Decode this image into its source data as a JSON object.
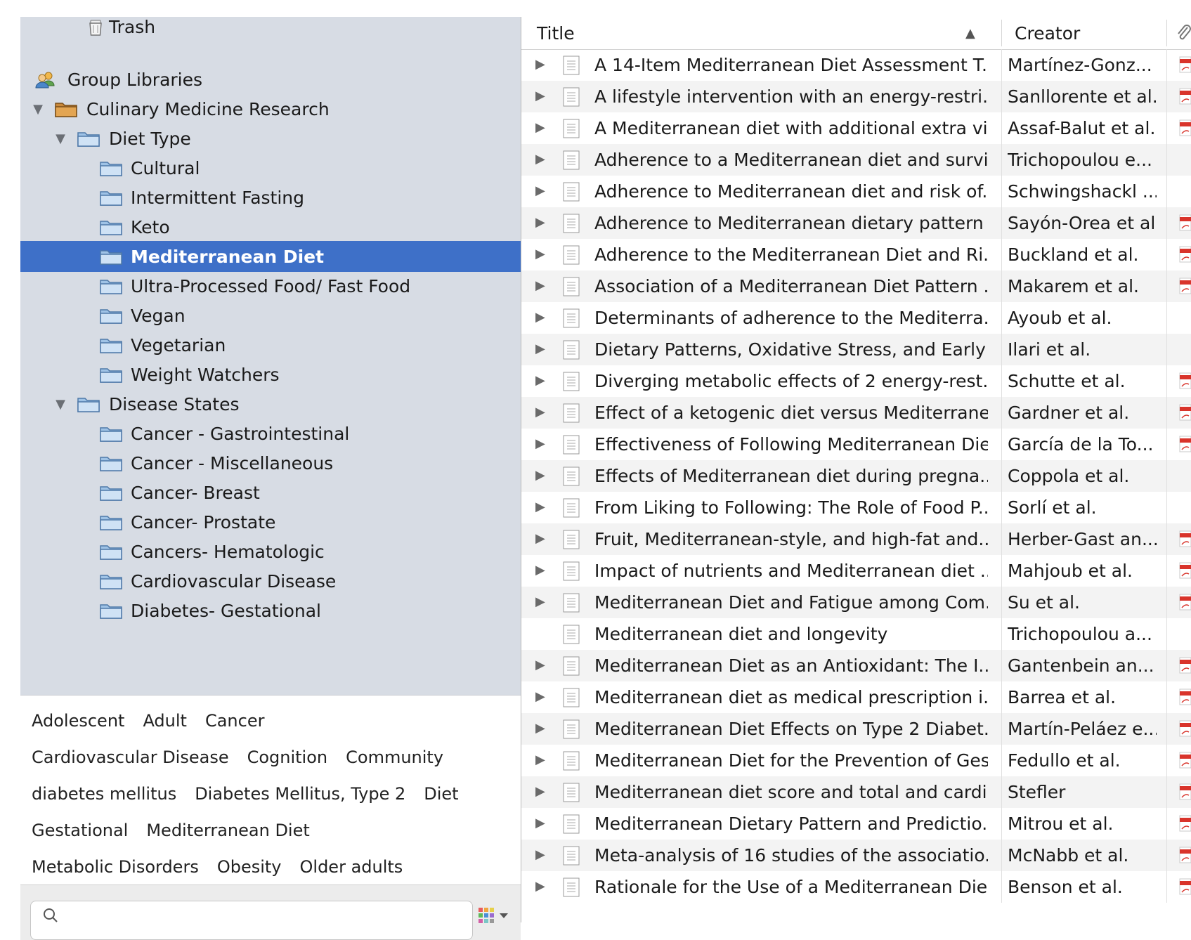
{
  "sidebar": {
    "items": [
      {
        "label": "Trash",
        "icon": "trash-icon",
        "level": 2,
        "twisty": "none"
      },
      {
        "label": "Group Libraries",
        "icon": "group-icon",
        "level": 0,
        "twisty": "none"
      },
      {
        "label": "Culinary Medicine Research",
        "icon": "library-icon",
        "level": 0,
        "twisty": "open"
      },
      {
        "label": "Diet Type",
        "icon": "folder-icon",
        "level": 1,
        "twisty": "open"
      },
      {
        "label": "Cultural",
        "icon": "folder-icon",
        "level": 2,
        "twisty": "none"
      },
      {
        "label": "Intermittent Fasting",
        "icon": "folder-icon",
        "level": 2,
        "twisty": "none"
      },
      {
        "label": "Keto",
        "icon": "folder-icon",
        "level": 2,
        "twisty": "none"
      },
      {
        "label": "Mediterranean Diet",
        "icon": "folder-icon",
        "level": 2,
        "twisty": "none",
        "selected": true
      },
      {
        "label": "Ultra-Processed Food/ Fast Food",
        "icon": "folder-icon",
        "level": 2,
        "twisty": "none"
      },
      {
        "label": "Vegan",
        "icon": "folder-icon",
        "level": 2,
        "twisty": "none"
      },
      {
        "label": "Vegetarian",
        "icon": "folder-icon",
        "level": 2,
        "twisty": "none"
      },
      {
        "label": "Weight Watchers",
        "icon": "folder-icon",
        "level": 2,
        "twisty": "none"
      },
      {
        "label": "Disease States",
        "icon": "folder-icon",
        "level": 1,
        "twisty": "open"
      },
      {
        "label": "Cancer - Gastrointestinal",
        "icon": "folder-icon",
        "level": 2,
        "twisty": "none"
      },
      {
        "label": "Cancer - Miscellaneous",
        "icon": "folder-icon",
        "level": 2,
        "twisty": "none"
      },
      {
        "label": "Cancer- Breast",
        "icon": "folder-icon",
        "level": 2,
        "twisty": "none"
      },
      {
        "label": "Cancer- Prostate",
        "icon": "folder-icon",
        "level": 2,
        "twisty": "none"
      },
      {
        "label": "Cancers- Hematologic",
        "icon": "folder-icon",
        "level": 2,
        "twisty": "none"
      },
      {
        "label": "Cardiovascular Disease",
        "icon": "folder-icon",
        "level": 2,
        "twisty": "none"
      },
      {
        "label": "Diabetes- Gestational",
        "icon": "folder-icon",
        "level": 2,
        "twisty": "none"
      }
    ]
  },
  "tags": {
    "lines": [
      [
        "Adolescent",
        "Adult",
        "Cancer"
      ],
      [
        "Cardiovascular Disease",
        "Cognition",
        "Community"
      ],
      [
        "diabetes mellitus",
        "Diabetes Mellitus, Type 2",
        "Diet"
      ],
      [
        "Gestational",
        "Mediterranean Diet"
      ],
      [
        "Metabolic Disorders",
        "Obesity",
        "Older adults"
      ]
    ]
  },
  "search": {
    "placeholder": ""
  },
  "columns": {
    "title": "Title",
    "creator": "Creator",
    "sort_indicator": "▲"
  },
  "items": [
    {
      "title": "A 14-Item Mediterranean Diet Assessment T...",
      "creator": "Martínez-Gonz...",
      "pdf": true,
      "expand": true
    },
    {
      "title": "A lifestyle intervention with an energy-restri...",
      "creator": "Sanllorente et al.",
      "pdf": true,
      "expand": true
    },
    {
      "title": "A Mediterranean diet with additional extra vi...",
      "creator": "Assaf-Balut et al.",
      "pdf": true,
      "expand": true
    },
    {
      "title": "Adherence to a Mediterranean diet and survi...",
      "creator": "Trichopoulou e...",
      "pdf": false,
      "expand": true
    },
    {
      "title": "Adherence to Mediterranean diet and risk of...",
      "creator": "Schwingshackl ...",
      "pdf": false,
      "expand": true
    },
    {
      "title": "Adherence to Mediterranean dietary pattern ...",
      "creator": "Sayón-Orea et al.",
      "pdf": true,
      "expand": true
    },
    {
      "title": "Adherence to the Mediterranean Diet and Ri...",
      "creator": "Buckland et al.",
      "pdf": true,
      "expand": true
    },
    {
      "title": "Association of a Mediterranean Diet Pattern ...",
      "creator": "Makarem et al.",
      "pdf": true,
      "expand": true
    },
    {
      "title": "Determinants of adherence to the Mediterra...",
      "creator": "Ayoub et al.",
      "pdf": false,
      "expand": true
    },
    {
      "title": "Dietary Patterns, Oxidative Stress, and Early ...",
      "creator": "Ilari et al.",
      "pdf": false,
      "expand": true
    },
    {
      "title": "Diverging metabolic effects of 2 energy-rest...",
      "creator": "Schutte et al.",
      "pdf": true,
      "expand": true
    },
    {
      "title": "Effect of a ketogenic diet versus Mediterrane...",
      "creator": "Gardner et al.",
      "pdf": true,
      "expand": true
    },
    {
      "title": "Effectiveness of Following Mediterranean Die...",
      "creator": "García de la To...",
      "pdf": true,
      "expand": true
    },
    {
      "title": "Effects of Mediterranean diet during pregna...",
      "creator": "Coppola et al.",
      "pdf": false,
      "expand": true
    },
    {
      "title": "From Liking to Following: The Role of Food P...",
      "creator": "Sorlí et al.",
      "pdf": false,
      "expand": true
    },
    {
      "title": "Fruit, Mediterranean-style, and high-fat and...",
      "creator": "Herber-Gast an...",
      "pdf": true,
      "expand": true
    },
    {
      "title": "Impact of nutrients and Mediterranean diet ...",
      "creator": "Mahjoub et al.",
      "pdf": true,
      "expand": true
    },
    {
      "title": "Mediterranean Diet and Fatigue among Com...",
      "creator": "Su et al.",
      "pdf": true,
      "expand": true
    },
    {
      "title": "Mediterranean diet and longevity",
      "creator": "Trichopoulou a...",
      "pdf": false,
      "expand": false
    },
    {
      "title": "Mediterranean Diet as an Antioxidant: The I...",
      "creator": "Gantenbein an...",
      "pdf": true,
      "expand": true
    },
    {
      "title": "Mediterranean diet as medical prescription i...",
      "creator": "Barrea et al.",
      "pdf": true,
      "expand": true
    },
    {
      "title": "Mediterranean Diet Effects on Type 2 Diabet...",
      "creator": "Martín-Peláez e...",
      "pdf": true,
      "expand": true
    },
    {
      "title": "Mediterranean Diet for the Prevention of Ges...",
      "creator": "Fedullo et al.",
      "pdf": true,
      "expand": true
    },
    {
      "title": "Mediterranean diet score and total and cardi...",
      "creator": "Stefler",
      "pdf": true,
      "expand": true
    },
    {
      "title": "Mediterranean Dietary Pattern and Predictio...",
      "creator": "Mitrou et al.",
      "pdf": true,
      "expand": true
    },
    {
      "title": "Meta-analysis of 16 studies of the associatio...",
      "creator": "McNabb et al.",
      "pdf": true,
      "expand": true
    },
    {
      "title": "Rationale for the Use of a Mediterranean Die...",
      "creator": "Benson et al.",
      "pdf": true,
      "expand": true
    }
  ],
  "colors": {
    "sidebar_bg": "#d7dce4",
    "selection": "#3e70c8",
    "folder_fill": "#9fc3e6",
    "folder_stroke": "#4f79a8",
    "pdf_red": "#d9342b"
  }
}
